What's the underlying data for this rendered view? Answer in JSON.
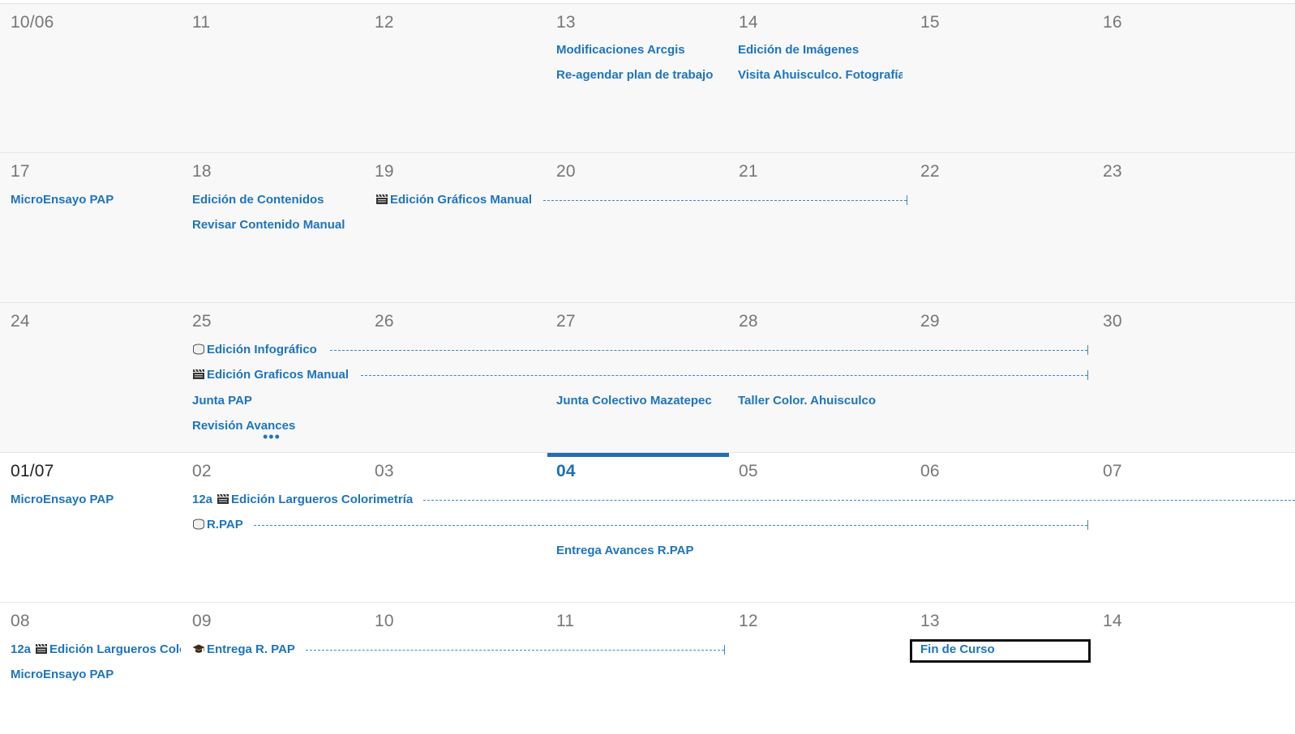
{
  "weeks": [
    {
      "days": [
        "10/06",
        "11",
        "12",
        "13",
        "14",
        "15",
        "16"
      ],
      "events": {
        "13a": "Modificaciones Arcgis",
        "13b": "Re-agendar plan de trabajo",
        "14a": "Edición de Imágenes",
        "14b": "Visita Ahuisculco. Fotografía"
      }
    },
    {
      "days": [
        "17",
        "18",
        "19",
        "20",
        "21",
        "22",
        "23"
      ],
      "events": {
        "17a": "MicroEnsayo PAP",
        "18a": "Edición de Contenidos",
        "18b": "Revisar Contenido Manual",
        "19a": "Edición Gráficos Manual"
      }
    },
    {
      "days": [
        "24",
        "25",
        "26",
        "27",
        "28",
        "29",
        "30"
      ],
      "events": {
        "25a": "Edición Infográfico",
        "25b": "Edición Graficos Manual",
        "25c": "Junta PAP",
        "25d": "Revisión Avances",
        "27a": "Junta Colectivo Mazatepec",
        "28a": "Taller Color. Ahuisculco"
      },
      "more": "•••"
    },
    {
      "days": [
        "01/07",
        "02",
        "03",
        "04",
        "05",
        "06",
        "07"
      ],
      "events": {
        "01a": "MicroEnsayo PAP",
        "02a_time": "12a",
        "02a": "Edición Largueros Colorimetría",
        "02b": "R.PAP",
        "04a": "Entrega Avances R.PAP"
      }
    },
    {
      "days": [
        "08",
        "09",
        "10",
        "11",
        "12",
        "13",
        "14"
      ],
      "events": {
        "08a_time": "12a",
        "08a": "Edición Largueros Colorimetría",
        "08b": "MicroEnsayo PAP",
        "09a": "Entrega R. PAP",
        "13a": "Fin de Curso"
      }
    }
  ],
  "icons": {
    "clapper": "clapperboard-icon",
    "disk": "disk-icon",
    "grad": "graduation-cap-icon"
  },
  "colors": {
    "event_text": "#1e74be",
    "today_accent": "#1f6fb2",
    "past_bg": "#f8f8f8"
  }
}
